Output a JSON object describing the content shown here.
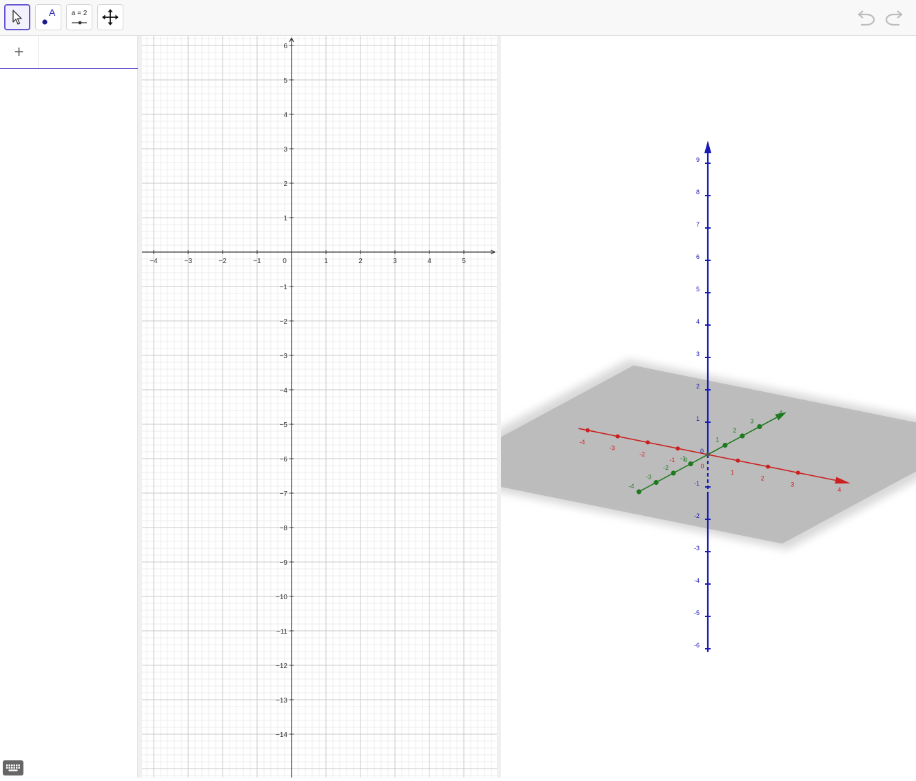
{
  "toolbar": {
    "tools": [
      {
        "name": "move-tool",
        "icon": "cursor-arrow-icon"
      },
      {
        "name": "point-tool",
        "icon": "point-A-icon",
        "label": "A"
      },
      {
        "name": "slider-tool",
        "icon": "slider-icon",
        "label": "a = 2"
      },
      {
        "name": "move-graphics-view-tool",
        "icon": "move-cross-icon"
      }
    ],
    "active_tool": "move-tool",
    "undo_icon": "undo-icon",
    "redo_icon": "redo-icon"
  },
  "algebra": {
    "add_label": "+",
    "keyboard_icon": "keyboard-icon"
  },
  "graphics2d": {
    "x_ticks": [
      "−4",
      "−3",
      "−2",
      "−1",
      "0",
      "1",
      "2",
      "3",
      "4",
      "5"
    ],
    "y_ticks": [
      "6",
      "5",
      "4",
      "3",
      "2",
      "1",
      "−1",
      "−2",
      "−3",
      "−4",
      "−5",
      "−6",
      "−7",
      "−8",
      "−9",
      "−10",
      "−11",
      "−12",
      "−13",
      "−14"
    ]
  },
  "graphics3d": {
    "x_axis_ticks": [
      "-4",
      "-3",
      "-2",
      "-1",
      "0",
      "1",
      "2",
      "3",
      "4"
    ],
    "y_axis_ticks": [
      "-4",
      "-3",
      "-2",
      "-1",
      "0",
      "1",
      "2",
      "3",
      "4"
    ],
    "z_axis_ticks": [
      "9",
      "8",
      "7",
      "6",
      "5",
      "4",
      "3",
      "2",
      "1",
      "0",
      "-1",
      "-2",
      "-3",
      "-4",
      "-5",
      "-6"
    ],
    "colors": {
      "x_axis": "#cc1f1f",
      "y_axis": "#1e7a1e",
      "z_axis": "#1a1ab8",
      "plane": "#b9b9b9"
    }
  },
  "colors": {
    "accent": "#6557d2",
    "grid_major": "#c8c8c8",
    "grid_minor": "#ececec"
  }
}
